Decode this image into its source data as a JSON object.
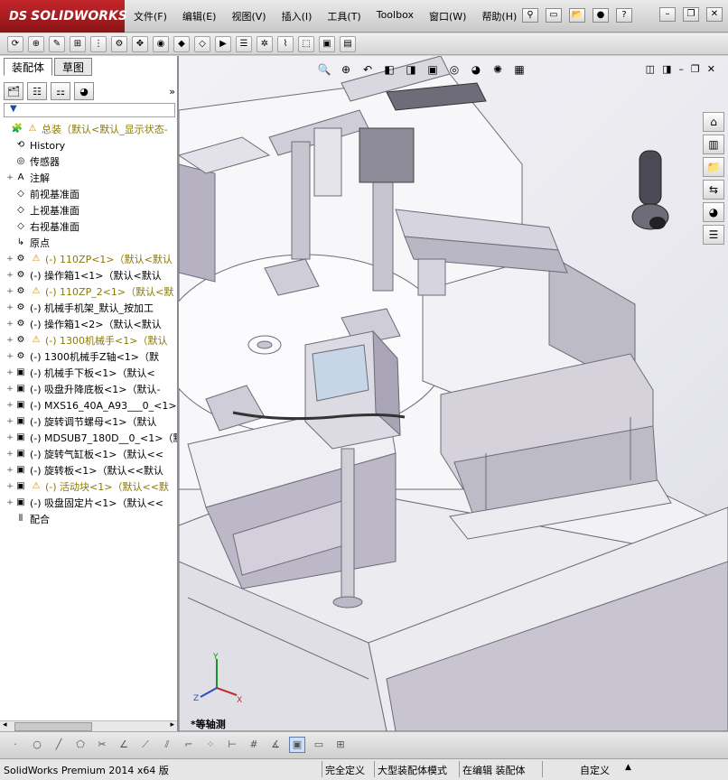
{
  "app": {
    "logo_ds": "DS",
    "logo_text": "SOLIDWORKS"
  },
  "menu": [
    "文件(F)",
    "编辑(E)",
    "视图(V)",
    "插入(I)",
    "工具(T)",
    "Toolbox",
    "窗口(W)",
    "帮助(H)"
  ],
  "left_panel": {
    "tabs": [
      "装配体",
      "草图"
    ],
    "expand_icon": "»",
    "filter_icon": "filter-icon",
    "tree": [
      {
        "label": "总装",
        "suffix": "（默认<默认_显示状态-",
        "icon": "assembly-icon",
        "warn": true,
        "exp": "",
        "cls": "yellowtxt"
      },
      {
        "label": "History",
        "suffix": "",
        "icon": "history-icon",
        "warn": false,
        "exp": "",
        "cls": ""
      },
      {
        "label": "传感器",
        "suffix": "",
        "icon": "sensor-icon",
        "warn": false,
        "exp": "",
        "cls": ""
      },
      {
        "label": "注解",
        "suffix": "",
        "icon": "annotation-icon",
        "warn": false,
        "exp": "+",
        "cls": ""
      },
      {
        "label": "前视基准面",
        "suffix": "",
        "icon": "plane-icon",
        "warn": false,
        "exp": "",
        "cls": ""
      },
      {
        "label": "上视基准面",
        "suffix": "",
        "icon": "plane-icon",
        "warn": false,
        "exp": "",
        "cls": ""
      },
      {
        "label": "右视基准面",
        "suffix": "",
        "icon": "plane-icon",
        "warn": false,
        "exp": "",
        "cls": ""
      },
      {
        "label": "原点",
        "suffix": "",
        "icon": "origin-icon",
        "warn": false,
        "exp": "",
        "cls": ""
      },
      {
        "label": "(-) 110ZP<1>",
        "suffix": "（默认<默认",
        "icon": "subassembly-icon",
        "warn": true,
        "exp": "+",
        "cls": "yellowtxt"
      },
      {
        "label": "(-) 操作箱1<1>",
        "suffix": "（默认<默认",
        "icon": "subassembly-icon",
        "warn": false,
        "exp": "+",
        "cls": ""
      },
      {
        "label": "(-) 110ZP_2<1>",
        "suffix": "（默认<默",
        "icon": "subassembly-icon",
        "warn": true,
        "exp": "+",
        "cls": "yellowtxt"
      },
      {
        "label": "(-) 机械手机架_默认_按加工",
        "suffix": "",
        "icon": "subassembly-icon",
        "warn": false,
        "exp": "+",
        "cls": ""
      },
      {
        "label": "(-) 操作箱1<2>",
        "suffix": "（默认<默认",
        "icon": "subassembly-icon",
        "warn": false,
        "exp": "+",
        "cls": ""
      },
      {
        "label": "(-) 1300机械手<1>",
        "suffix": "（默认",
        "icon": "subassembly-icon",
        "warn": true,
        "exp": "+",
        "cls": "yellowtxt"
      },
      {
        "label": "(-) 1300机械手Z轴<1>",
        "suffix": "（默",
        "icon": "subassembly-icon",
        "warn": false,
        "exp": "+",
        "cls": ""
      },
      {
        "label": "(-) 机械手下板<1>",
        "suffix": "（默认<",
        "icon": "part-icon",
        "warn": false,
        "exp": "+",
        "cls": ""
      },
      {
        "label": "(-) 吸盘升降底板<1>",
        "suffix": "（默认-",
        "icon": "part-icon",
        "warn": false,
        "exp": "+",
        "cls": ""
      },
      {
        "label": "(-) MXS16_40A_A93___0_<1>",
        "suffix": "",
        "icon": "part-icon",
        "warn": false,
        "exp": "+",
        "cls": ""
      },
      {
        "label": "(-) 旋转调节螺母<1>",
        "suffix": "（默认",
        "icon": "part-icon",
        "warn": false,
        "exp": "+",
        "cls": ""
      },
      {
        "label": "(-) MDSUB7_180D__0_<1>",
        "suffix": "（默",
        "icon": "part-icon",
        "warn": false,
        "exp": "+",
        "cls": ""
      },
      {
        "label": "(-) 旋转气缸板<1>",
        "suffix": "（默认<<",
        "icon": "part-icon",
        "warn": false,
        "exp": "+",
        "cls": ""
      },
      {
        "label": "(-) 旋转板<1>",
        "suffix": "（默认<<默认",
        "icon": "part-icon",
        "warn": false,
        "exp": "+",
        "cls": ""
      },
      {
        "label": "(-) 活动块<1>",
        "suffix": "（默认<<默",
        "icon": "part-icon",
        "warn": true,
        "exp": "+",
        "cls": "yellowtxt"
      },
      {
        "label": "(-) 吸盘固定片<1>",
        "suffix": "（默认<<",
        "icon": "part-icon",
        "warn": false,
        "exp": "+",
        "cls": ""
      },
      {
        "label": "配合",
        "suffix": "",
        "icon": "mates-icon",
        "warn": false,
        "exp": "",
        "cls": ""
      }
    ]
  },
  "viewport": {
    "view_label": "*等轴测",
    "triad": {
      "x": "X",
      "y": "Y",
      "z": "Z"
    }
  },
  "status": {
    "app_version": "SolidWorks Premium 2014 x64 版",
    "s1": "完全定义",
    "s2": "大型装配体模式",
    "s3": "在编辑 装配体",
    "s4": "自定义"
  },
  "colors": {
    "model_gray": "#bdbcc6",
    "model_light": "#ecebf0",
    "model_dark": "#6d6c78",
    "accent_red": "#b32025"
  }
}
